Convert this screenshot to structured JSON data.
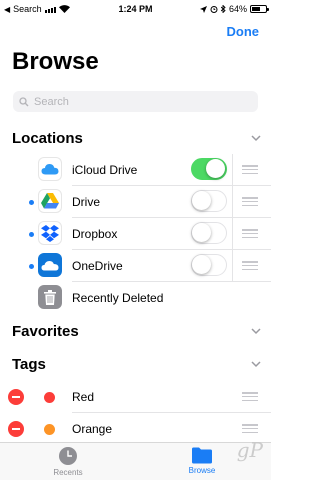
{
  "status_bar": {
    "back_label": "Search",
    "time": "1:24 PM",
    "battery": "64%",
    "battery_level": 0.64
  },
  "nav": {
    "done_label": "Done",
    "title": "Browse"
  },
  "search": {
    "placeholder": "Search"
  },
  "locations": {
    "title": "Locations",
    "items": [
      {
        "label": "iCloud Drive",
        "icon": "icloud-icon",
        "enabled": true,
        "dot": false
      },
      {
        "label": "Drive",
        "icon": "google-drive-icon",
        "enabled": false,
        "dot": true
      },
      {
        "label": "Dropbox",
        "icon": "dropbox-icon",
        "enabled": false,
        "dot": true
      },
      {
        "label": "OneDrive",
        "icon": "onedrive-icon",
        "enabled": false,
        "dot": true
      },
      {
        "label": "Recently Deleted",
        "icon": "trash-icon"
      }
    ]
  },
  "favorites": {
    "title": "Favorites"
  },
  "tags": {
    "title": "Tags",
    "items": [
      {
        "label": "Red",
        "color": "#fc3d39"
      },
      {
        "label": "Orange",
        "color": "#fd9426"
      }
    ]
  },
  "tab_bar": {
    "recents_label": "Recents",
    "browse_label": "Browse"
  },
  "watermark": "gP",
  "colors": {
    "accent": "#1a7df5",
    "toggle_on": "#4cd964",
    "delete": "#fc3d39"
  }
}
